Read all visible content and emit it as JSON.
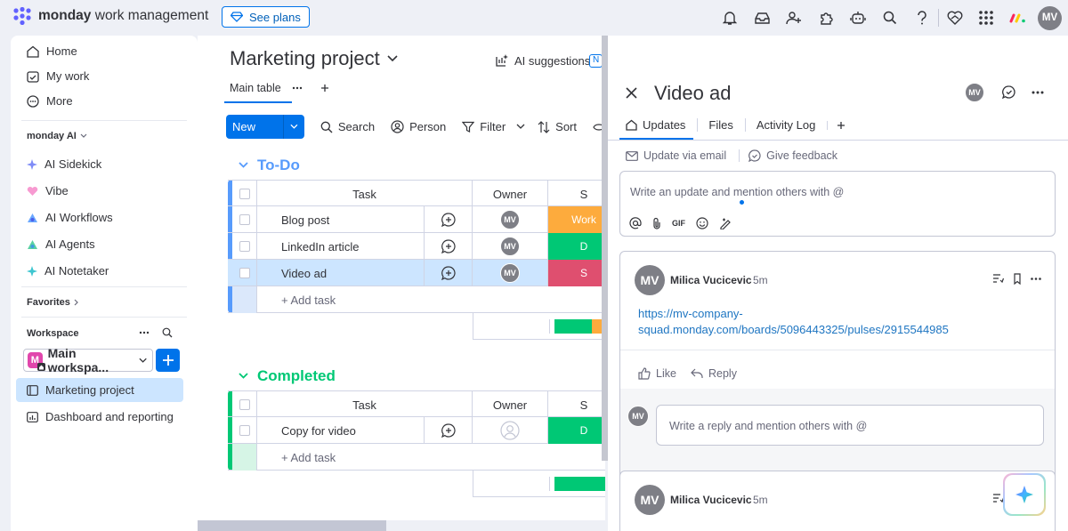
{
  "brand": {
    "bold": "monday",
    "rest": " work management"
  },
  "topbar": {
    "see_plans": "See plans",
    "avatar": "MV"
  },
  "sidebar": {
    "nav": [
      "Home",
      "My work",
      "More"
    ],
    "ai_header": "monday AI",
    "ai_items": [
      "AI Sidekick",
      "Vibe",
      "AI Workflows",
      "AI Agents",
      "AI Notetaker"
    ],
    "favorites": "Favorites",
    "workspace_header": "Workspace",
    "workspace_name": "Main workspa...",
    "workspace_badge": "M",
    "boards": [
      "Marketing project",
      "Dashboard and reporting"
    ]
  },
  "board": {
    "title": "Marketing project",
    "ai_suggestions": "AI suggestions",
    "ai_badge": "N",
    "tab_main": "Main table",
    "toolbar": {
      "new_task": "New task",
      "search": "Search",
      "person": "Person",
      "filter": "Filter",
      "sort": "Sort"
    },
    "groups": [
      {
        "name": "To-Do",
        "color": "#579bfc",
        "columns": {
          "task": "Task",
          "owner": "Owner",
          "status": "S"
        },
        "rows": [
          {
            "task": "Blog post",
            "owner": "MV",
            "status": "Work",
            "status_color": "#fdab3d",
            "selected": false
          },
          {
            "task": "LinkedIn article",
            "owner": "MV",
            "status": "D",
            "status_color": "#00c875",
            "selected": false
          },
          {
            "task": "Video ad",
            "owner": "MV",
            "status": "S",
            "status_color": "#df4f6f",
            "selected": true
          }
        ],
        "add_task": "+ Add task"
      },
      {
        "name": "Completed",
        "color": "#00c875",
        "columns": {
          "task": "Task",
          "owner": "Owner",
          "status": "S"
        },
        "rows": [
          {
            "task": "Copy for video",
            "owner": "",
            "status": "D",
            "status_color": "#00c875",
            "selected": false
          }
        ],
        "add_task": "+ Add task"
      }
    ]
  },
  "panel": {
    "title": "Video ad",
    "avatar": "MV",
    "tabs": [
      "Updates",
      "Files",
      "Activity Log"
    ],
    "update_via_email": "Update via email",
    "give_feedback": "Give feedback",
    "editor_placeholder": "Write an update and mention others with @",
    "editor_gif": "GIF",
    "posts": [
      {
        "author": "Milica Vucicevic",
        "time": "5m",
        "avatar": "MV",
        "link_line1": "https://mv-company-",
        "link_line2": "squad.monday.com/boards/5096443325/pulses/2915544985",
        "like": "Like",
        "reply": "Reply",
        "reply_placeholder": "Write a reply and mention others with @"
      },
      {
        "author": "Milica Vucicevic",
        "time": "5m",
        "avatar": "MV"
      }
    ]
  }
}
